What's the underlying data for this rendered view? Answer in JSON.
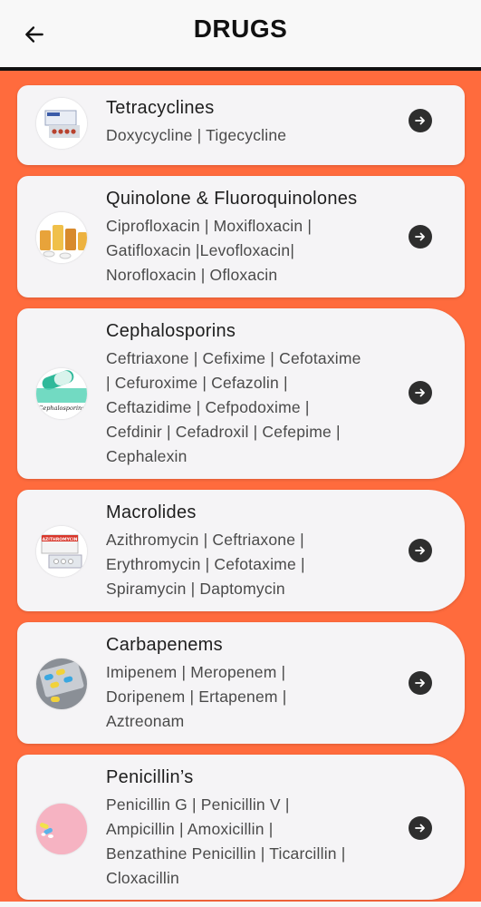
{
  "appbar": {
    "title": "DRUGS",
    "back_icon": "arrow-left-icon"
  },
  "colors": {
    "background": "#FF6B3D",
    "card": "#F5F4F6",
    "arrow_button": "#2E2E2E"
  },
  "drug_classes": [
    {
      "title": "Tetracyclines",
      "drugs": "Doxycycline | Tigecycline",
      "thumb_icon": "tetracycline-pack-image"
    },
    {
      "title": "Quinolone & Fluoroquinolones",
      "drugs": "Ciprofloxacin | Moxifloxacin |\nGatifloxacin |Levofloxacin|\nNorofloxacin | Ofloxacin",
      "thumb_icon": "quinolone-pills-image"
    },
    {
      "title": "Cephalosporins",
      "drugs": "Ceftriaxone | Cefixime | Cefotaxime\n| Cefuroxime | Cefazolin |\nCeftazidime | Cefpodoxime |\nCefdinir | Cefadroxil | Cefepime |\nCephalexin",
      "thumb_icon": "cephalosporin-capsule-image",
      "thumb_caption": "Cephalosporins"
    },
    {
      "title": "Macrolides",
      "drugs": "Azithromycin | Ceftriaxone |\nErythromycin | Cefotaxime |\nSpiramycin | Daptomycin",
      "thumb_icon": "azithromycin-pack-image",
      "thumb_caption": "AZITHROMYCIN"
    },
    {
      "title": "Carbapenems",
      "drugs": "Imipenem | Meropenem  |\nDoripenem  | Ertapenem  |\nAztreonam",
      "thumb_icon": "carbapenem-blister-image"
    },
    {
      "title": "Penicillin’s",
      "drugs": "Penicillin G | Penicillin V |\nAmpicillin  | Amoxicillin |\nBenzathine Penicillin | Ticarcillin |\nCloxacillin",
      "thumb_icon": "penicillin-pills-image"
    }
  ]
}
